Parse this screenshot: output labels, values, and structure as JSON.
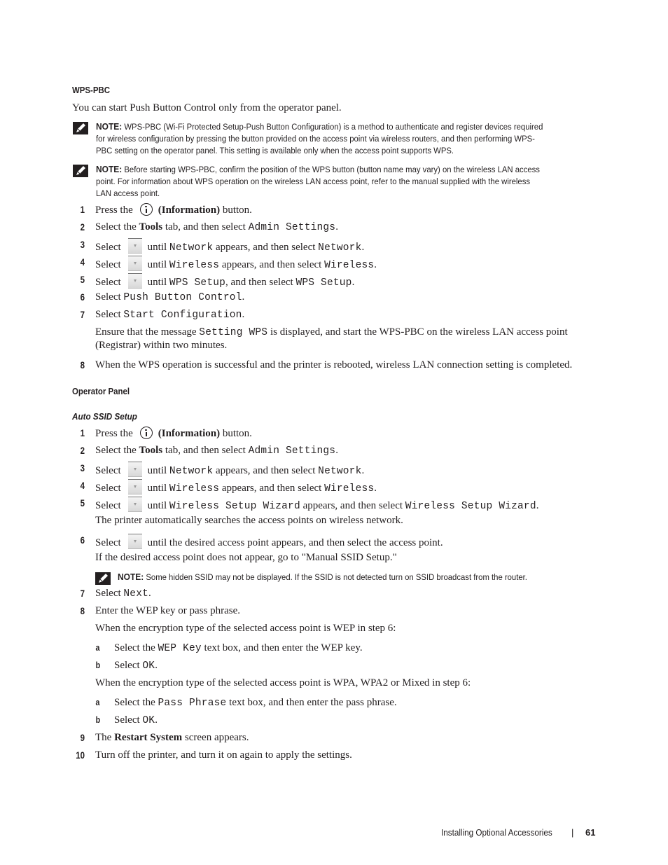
{
  "section1": {
    "heading": "WPS-PBC",
    "intro": "You can start Push Button Control only from the operator panel.",
    "notes": [
      {
        "label": "NOTE:",
        "lines": [
          "WPS-PBC (Wi-Fi Protected Setup-Push Button Configuration) is a method to authenticate and register devices required",
          "for wireless configuration by pressing the button provided on the access point via wireless routers, and then performing WPS-",
          "PBC setting on the operator panel. This setting is available only when the access point supports WPS."
        ]
      },
      {
        "label": "NOTE:",
        "lines": [
          "Before starting WPS-PBC, confirm the position of the WPS button (button name may vary) on the wireless LAN access",
          "point. For information about WPS operation on the wireless LAN access point, refer to the manual supplied with the wireless",
          "LAN access point."
        ]
      }
    ],
    "steps": [
      {
        "num": "1",
        "pre": "Press the",
        "icon": "information-icon",
        "bold": "(Information)",
        "post": "button."
      },
      {
        "num": "2",
        "pre": "Select the",
        "bold": "Tools",
        "mid": "tab, and then select",
        "code": "Admin Settings",
        "post": "."
      },
      {
        "num": "3",
        "pre": "Select",
        "icon": "down-arrow-button",
        "mid": "until",
        "code": "Network",
        "mid2": "appears, and then select",
        "code2": "Network",
        "post": "."
      },
      {
        "num": "4",
        "pre": "Select",
        "icon": "down-arrow-button",
        "mid": "until",
        "code": "Wireless",
        "mid2": "appears, and then select",
        "code2": "Wireless",
        "post": "."
      },
      {
        "num": "5",
        "pre": "Select",
        "icon": "down-arrow-button",
        "mid": "until",
        "code": "WPS Setup",
        "mid2": ", and then select",
        "code2": "WPS Setup",
        "post": "."
      },
      {
        "num": "6",
        "pre": "Select",
        "code": "Push Button Control",
        "post": "."
      },
      {
        "num": "7",
        "pre": "Select",
        "code": "Start Configuration",
        "post": "."
      },
      {
        "num": "8",
        "text": "When the WPS operation is successful and the printer is rebooted, wireless LAN connection setting is completed."
      }
    ],
    "step7_detail": {
      "pre": "Ensure that the message",
      "code": "Setting WPS",
      "post": "is displayed, and start the WPS-PBC on the wireless LAN access point",
      "line2": "(Registrar) within two minutes."
    }
  },
  "section2": {
    "heading": "Operator Panel",
    "subheading": "Auto SSID Setup",
    "steps": [
      {
        "num": "1",
        "pre": "Press the",
        "bold": "(Information)",
        "post": "button."
      },
      {
        "num": "2",
        "pre": "Select the",
        "bold": "Tools",
        "mid": "tab, and then select",
        "code": "Admin Settings",
        "post": "."
      },
      {
        "num": "3",
        "pre": "Select",
        "mid": "until",
        "code": "Network",
        "mid2": "appears, and then select",
        "code2": "Network",
        "post": "."
      },
      {
        "num": "4",
        "pre": "Select",
        "mid": "until",
        "code": "Wireless",
        "mid2": "appears, and then select",
        "code2": "Wireless",
        "post": "."
      },
      {
        "num": "5",
        "pre": "Select",
        "mid": "until",
        "code": "Wireless Setup Wizard",
        "mid2": "appears, and then select",
        "code2": "Wireless Setup Wizard",
        "post": "."
      },
      {
        "num": "6",
        "pre": "Select",
        "mid": "until the desired access point appears, and then select the access point."
      },
      {
        "num": "7",
        "pre": "Select",
        "code": "Next",
        "post": "."
      },
      {
        "num": "8",
        "text": "Enter the WEP key or pass phrase."
      },
      {
        "num": "9",
        "pre": "The",
        "bold": "Restart System",
        "post": "screen appears."
      },
      {
        "num": "10",
        "text": "Turn off the printer, and turn it on again to apply the settings."
      }
    ],
    "step5_detail": "The printer automatically searches the access points on wireless network.",
    "step6_detail": "If  the desired access point does not appear,  go to \"Manual SSID Setup.\"",
    "step6_note": {
      "label": "NOTE:",
      "text": "Some hidden SSID may not be displayed. If the SSID is not detected turn on SSID broadcast from the router."
    },
    "step8_wep": {
      "intro": "When the encryption type of the selected access point is WEP in step 6:",
      "a": {
        "letter": "a",
        "pre": "Select the",
        "code": "WEP Key",
        "post": "text box, and then enter the WEP key."
      },
      "b": {
        "letter": "b",
        "pre": "Select",
        "code": "OK",
        "post": "."
      }
    },
    "step8_wpa": {
      "intro": "When the encryption type of the selected access point is WPA, WPA2 or Mixed in step 6:",
      "a": {
        "letter": "a",
        "pre": "Select the",
        "code": "Pass Phrase",
        "post": "text box, and then enter the pass phrase."
      },
      "b": {
        "letter": "b",
        "pre": "Select",
        "code": "OK",
        "post": "."
      }
    }
  },
  "footer": {
    "chapter": "Installing Optional Accessories",
    "separator": "|",
    "page_number": "61"
  }
}
